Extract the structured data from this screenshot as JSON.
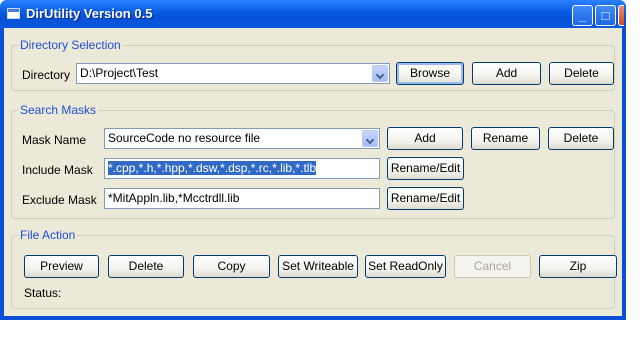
{
  "window": {
    "title": "DirUtility Version 0.5",
    "controls": {
      "minimize": "_",
      "maximize": "□",
      "close": "✕"
    }
  },
  "directory_selection": {
    "legend": "Directory Selection",
    "label": "Directory",
    "value": "D:\\Project\\Test",
    "browse": "Browse",
    "add": "Add",
    "delete": "Delete"
  },
  "search_masks": {
    "legend": "Search Masks",
    "mask_name_label": "Mask Name",
    "mask_name_value": "SourceCode no resource file",
    "add": "Add",
    "rename": "Rename",
    "delete": "Delete",
    "include_label": "Include Mask",
    "include_value": "*.cpp,*.h,*.hpp,*.dsw,*.dsp,*.rc,*.lib,*.tlb",
    "include_rename": "Rename/Edit",
    "exclude_label": "Exclude Mask",
    "exclude_value": "*MitAppln.lib,*Mcctrdll.lib",
    "exclude_rename": "Rename/Edit"
  },
  "file_action": {
    "legend": "File Action",
    "buttons": {
      "preview": "Preview",
      "delete": "Delete",
      "copy": "Copy",
      "set_writeable": "Set Writeable",
      "set_readonly": "Set ReadOnly",
      "cancel": "Cancel",
      "zip": "Zip"
    },
    "status_label": "Status:"
  }
}
